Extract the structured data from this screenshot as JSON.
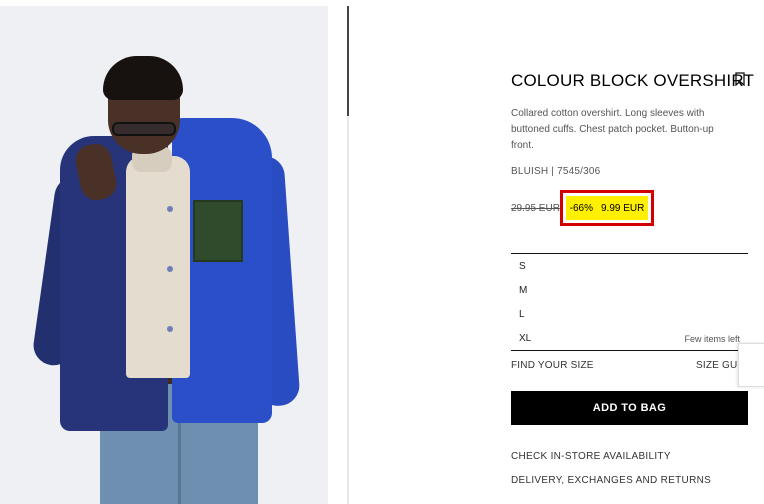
{
  "product": {
    "title": "COLOUR BLOCK OVERSHIRT",
    "description": "Collared cotton overshirt. Long sleeves with buttoned cuffs. Chest patch pocket. Button-up front.",
    "color_ref": "BLUISH | 7545/306",
    "price": {
      "original": "29.95 EUR",
      "discount": "-66%",
      "current": "9.99 EUR"
    }
  },
  "sizes": {
    "items": [
      "S",
      "M",
      "L",
      "XL"
    ],
    "xl_note": "Few items left"
  },
  "actions": {
    "find_size": "FIND YOUR SIZE",
    "size_guide": "SIZE GUIDE",
    "add_to_bag": "ADD TO BAG",
    "check_store": "CHECK IN-STORE AVAILABILITY",
    "delivery": "DELIVERY, EXCHANGES AND RETURNS"
  },
  "icons": {
    "bookmark": "bookmark-icon"
  },
  "colors": {
    "highlight_fill": "#ffef00",
    "highlight_border": "#d40000",
    "button_bg": "#000000"
  }
}
